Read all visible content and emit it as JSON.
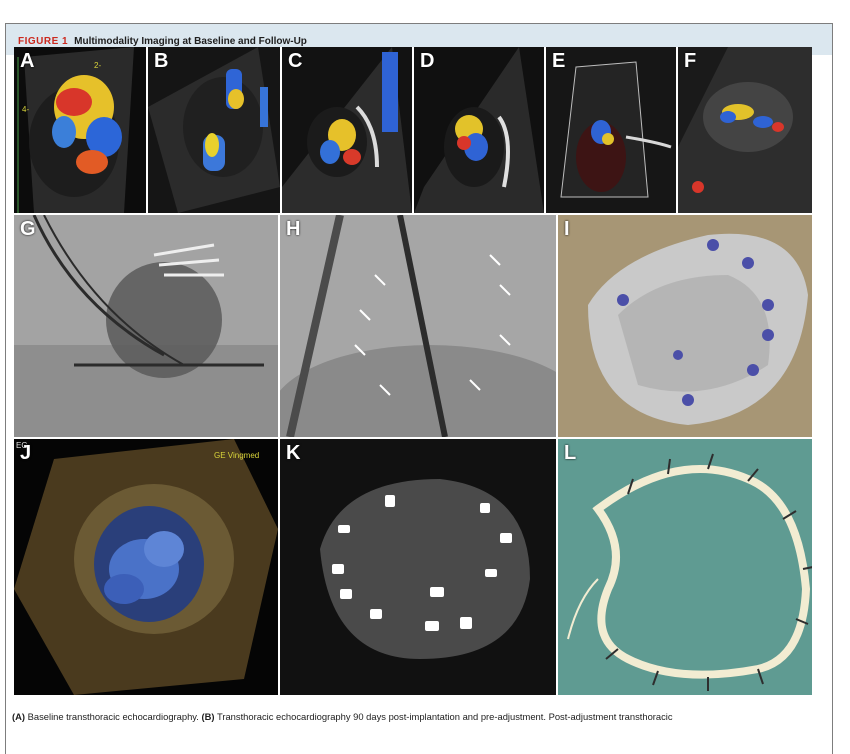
{
  "figure": {
    "label": "FIGURE 1",
    "title": "Multimodality Imaging at Baseline and Follow-Up"
  },
  "panels": [
    {
      "id": "A",
      "label": "A"
    },
    {
      "id": "B",
      "label": "B"
    },
    {
      "id": "C",
      "label": "C"
    },
    {
      "id": "D",
      "label": "D"
    },
    {
      "id": "E",
      "label": "E"
    },
    {
      "id": "F",
      "label": "F"
    },
    {
      "id": "G",
      "label": "G"
    },
    {
      "id": "H",
      "label": "H"
    },
    {
      "id": "I",
      "label": "I"
    },
    {
      "id": "J",
      "label": "J"
    },
    {
      "id": "K",
      "label": "K"
    },
    {
      "id": "L",
      "label": "L"
    }
  ],
  "overlays": {
    "depth_2": "2-",
    "depth_4": "4-",
    "ge_vingmed": "GE Vingmed",
    "eg": "EG"
  },
  "caption": {
    "a_label": "(A)",
    "a_text": " Baseline transthoracic echocardiography. ",
    "b_label": "(B)",
    "b_text": " Transthoracic echocardiography 90 days post-implantation and pre-adjustment. Post-adjustment transthoracic"
  },
  "colors": {
    "header_bg": "#dbe7ef",
    "figure_label": "#cc2a1f"
  }
}
